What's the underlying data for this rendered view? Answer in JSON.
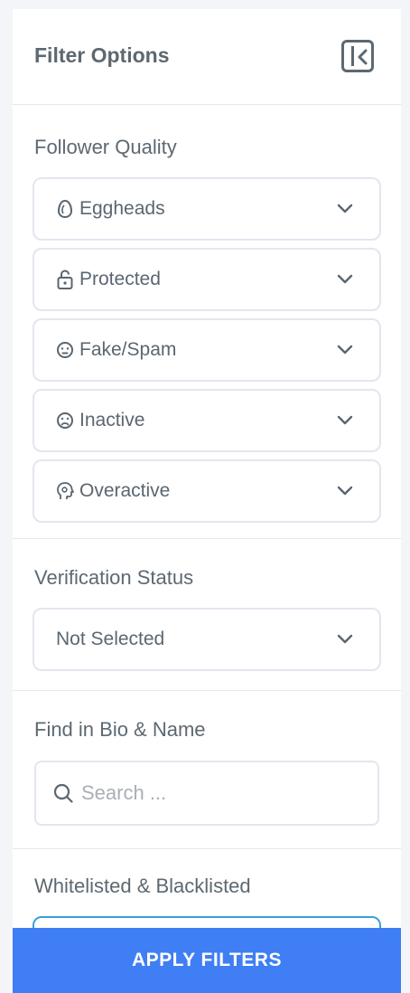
{
  "header": {
    "title": "Filter Options",
    "collapse_icon": "sidebar-collapse-icon"
  },
  "follower_quality": {
    "title": "Follower Quality",
    "items": [
      {
        "label": "Eggheads",
        "icon": "egg-icon"
      },
      {
        "label": "Protected",
        "icon": "lock-icon"
      },
      {
        "label": "Fake/Spam",
        "icon": "angry-face-icon"
      },
      {
        "label": "Inactive",
        "icon": "sad-face-icon"
      },
      {
        "label": "Overactive",
        "icon": "gear-head-icon"
      }
    ]
  },
  "verification": {
    "title": "Verification Status",
    "selected": "Not Selected"
  },
  "bio_search": {
    "title": "Find in Bio & Name",
    "placeholder": "Search ..."
  },
  "lists": {
    "title": "Whitelisted & Blacklisted"
  },
  "apply": {
    "label": "APPLY FILTERS"
  },
  "colors": {
    "accent": "#3f7ef5",
    "text": "#5b6670",
    "border": "#e3e6ef",
    "focus": "#3aa0d8"
  }
}
